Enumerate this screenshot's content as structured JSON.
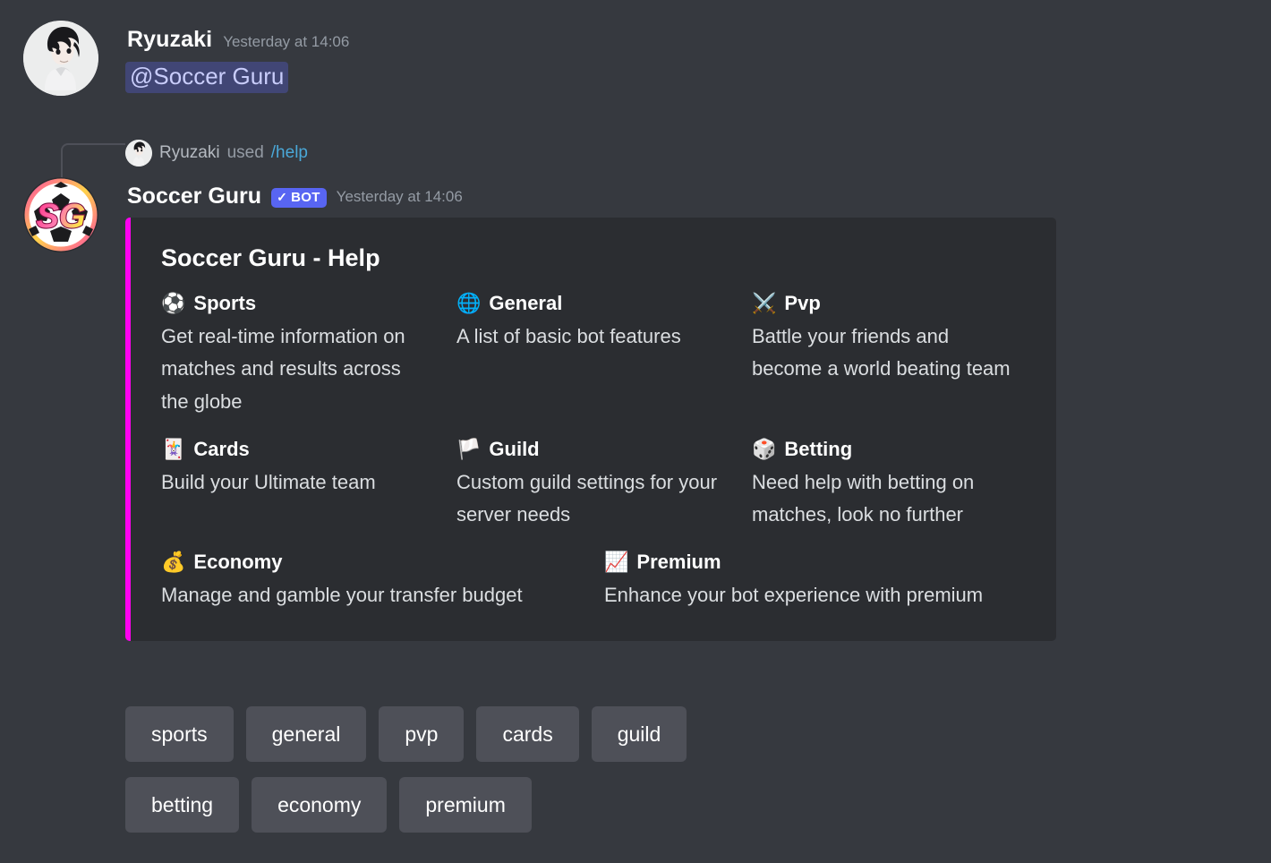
{
  "user_message": {
    "author": "Ryuzaki",
    "timestamp": "Yesterday at 14:06",
    "mention": "@Soccer Guru",
    "avatar_name": "ryuzaki-avatar"
  },
  "slash_header": {
    "author": "Ryuzaki",
    "used_text": "used",
    "command": "/help"
  },
  "bot_message": {
    "author": "Soccer Guru",
    "badge": "BOT",
    "badge_check": "✓",
    "timestamp": "Yesterday at 14:06"
  },
  "embed": {
    "accent_color": "#ff00f0",
    "background": "#2b2d31",
    "title": "Soccer Guru - Help",
    "fields_row1": [
      {
        "icon": "⚽",
        "icon_name": "soccer-ball-icon",
        "name": "Sports",
        "value": "Get real-time information on matches and results across the globe"
      },
      {
        "icon": "🌐",
        "icon_name": "globe-icon",
        "name": "General",
        "value": "A list of basic bot features"
      },
      {
        "icon": "⚔️",
        "icon_name": "crossed-swords-icon",
        "name": "Pvp",
        "value": "Battle your friends and become a world beating team"
      }
    ],
    "fields_row2": [
      {
        "icon": "🃏",
        "icon_name": "playing-card-icon",
        "name": "Cards",
        "value": "Build your Ultimate team"
      },
      {
        "icon": "🏳️",
        "icon_name": "white-flag-icon",
        "name": "Guild",
        "value": "Custom guild settings for your server needs"
      },
      {
        "icon": "🎲",
        "icon_name": "game-die-icon",
        "name": "Betting",
        "value": "Need help with betting on matches, look no further"
      }
    ],
    "fields_row3": [
      {
        "icon": "💰",
        "icon_name": "money-bag-icon",
        "name": "Economy",
        "value": "Manage and gamble your transfer budget"
      },
      {
        "icon": "📈",
        "icon_name": "chart-increasing-icon",
        "name": "Premium",
        "value": "Enhance your bot experience with premium"
      }
    ]
  },
  "buttons": {
    "row1": [
      "sports",
      "general",
      "pvp",
      "cards",
      "guild"
    ],
    "row2": [
      "betting",
      "economy",
      "premium"
    ]
  }
}
